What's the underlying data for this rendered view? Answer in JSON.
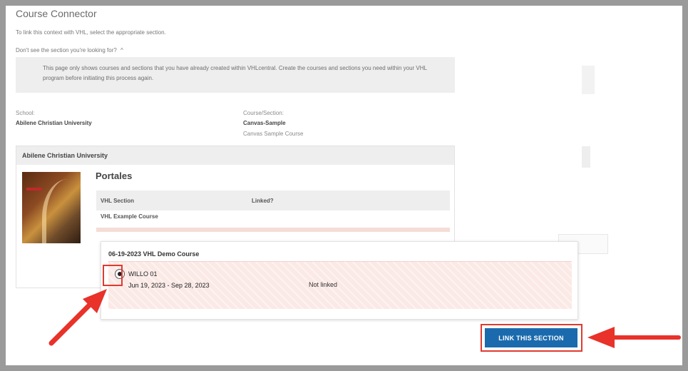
{
  "page": {
    "title": "Course Connector",
    "intro": "To link this context with VHL, select the appropriate section.",
    "dont_see_label": "Don't see the section you're looking for?",
    "dont_see_chevron": "^",
    "info_text": "This page only shows courses and sections that you have already created within VHLcentral. Create the courses and sections you need within your VHL program before initiating this process again."
  },
  "school": {
    "label": "School:",
    "name": "Abilene Christian University"
  },
  "course_section": {
    "label": "Course/Section:",
    "code": "Canvas-Sample",
    "name": "Canvas Sample Course"
  },
  "university_panel": {
    "title": "Abilene Christian University",
    "course_name": "Portales",
    "table_headers": {
      "section": "VHL Section",
      "linked": "Linked?"
    },
    "rows": [
      {
        "section": "VHL Example Course"
      }
    ]
  },
  "popup": {
    "title": "06-19-2023 VHL Demo Course",
    "section": {
      "name": "WILLO 01",
      "dates": "Jun 19, 2023 - Sep 28, 2023",
      "status": "Not linked",
      "selected": true
    }
  },
  "actions": {
    "link_button": "LINK THIS SECTION"
  },
  "colors": {
    "accent_button": "#1b6aad",
    "highlight": "#e03a2f",
    "row_bg": "#fbe9e6"
  }
}
